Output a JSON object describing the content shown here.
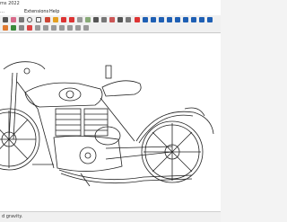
{
  "window": {
    "title": "ms 2022"
  },
  "menu": {
    "extensions": "Extensions",
    "help": "Help"
  },
  "toolbar": {
    "icons": [
      "select-icon",
      "eraser-icon",
      "pencil-icon",
      "arc-icon",
      "rectangle-icon",
      "shape-icon",
      "push-pull-icon",
      "move-icon",
      "rotate-icon",
      "scale-icon",
      "offset-icon",
      "tape-measure-icon",
      "text-icon",
      "paint-bucket-icon",
      "orbit-icon",
      "pan-icon",
      "zoom-icon",
      "zoom-extents-icon",
      "previous-view-icon",
      "next-view-icon",
      "xray-icon",
      "back-edges-icon",
      "wireframe-icon",
      "hidden-line-icon",
      "shaded-icon",
      "textured-icon",
      "monochrome-icon"
    ],
    "accent": "#1e5fb4"
  },
  "status": {
    "text": "d gravity."
  }
}
